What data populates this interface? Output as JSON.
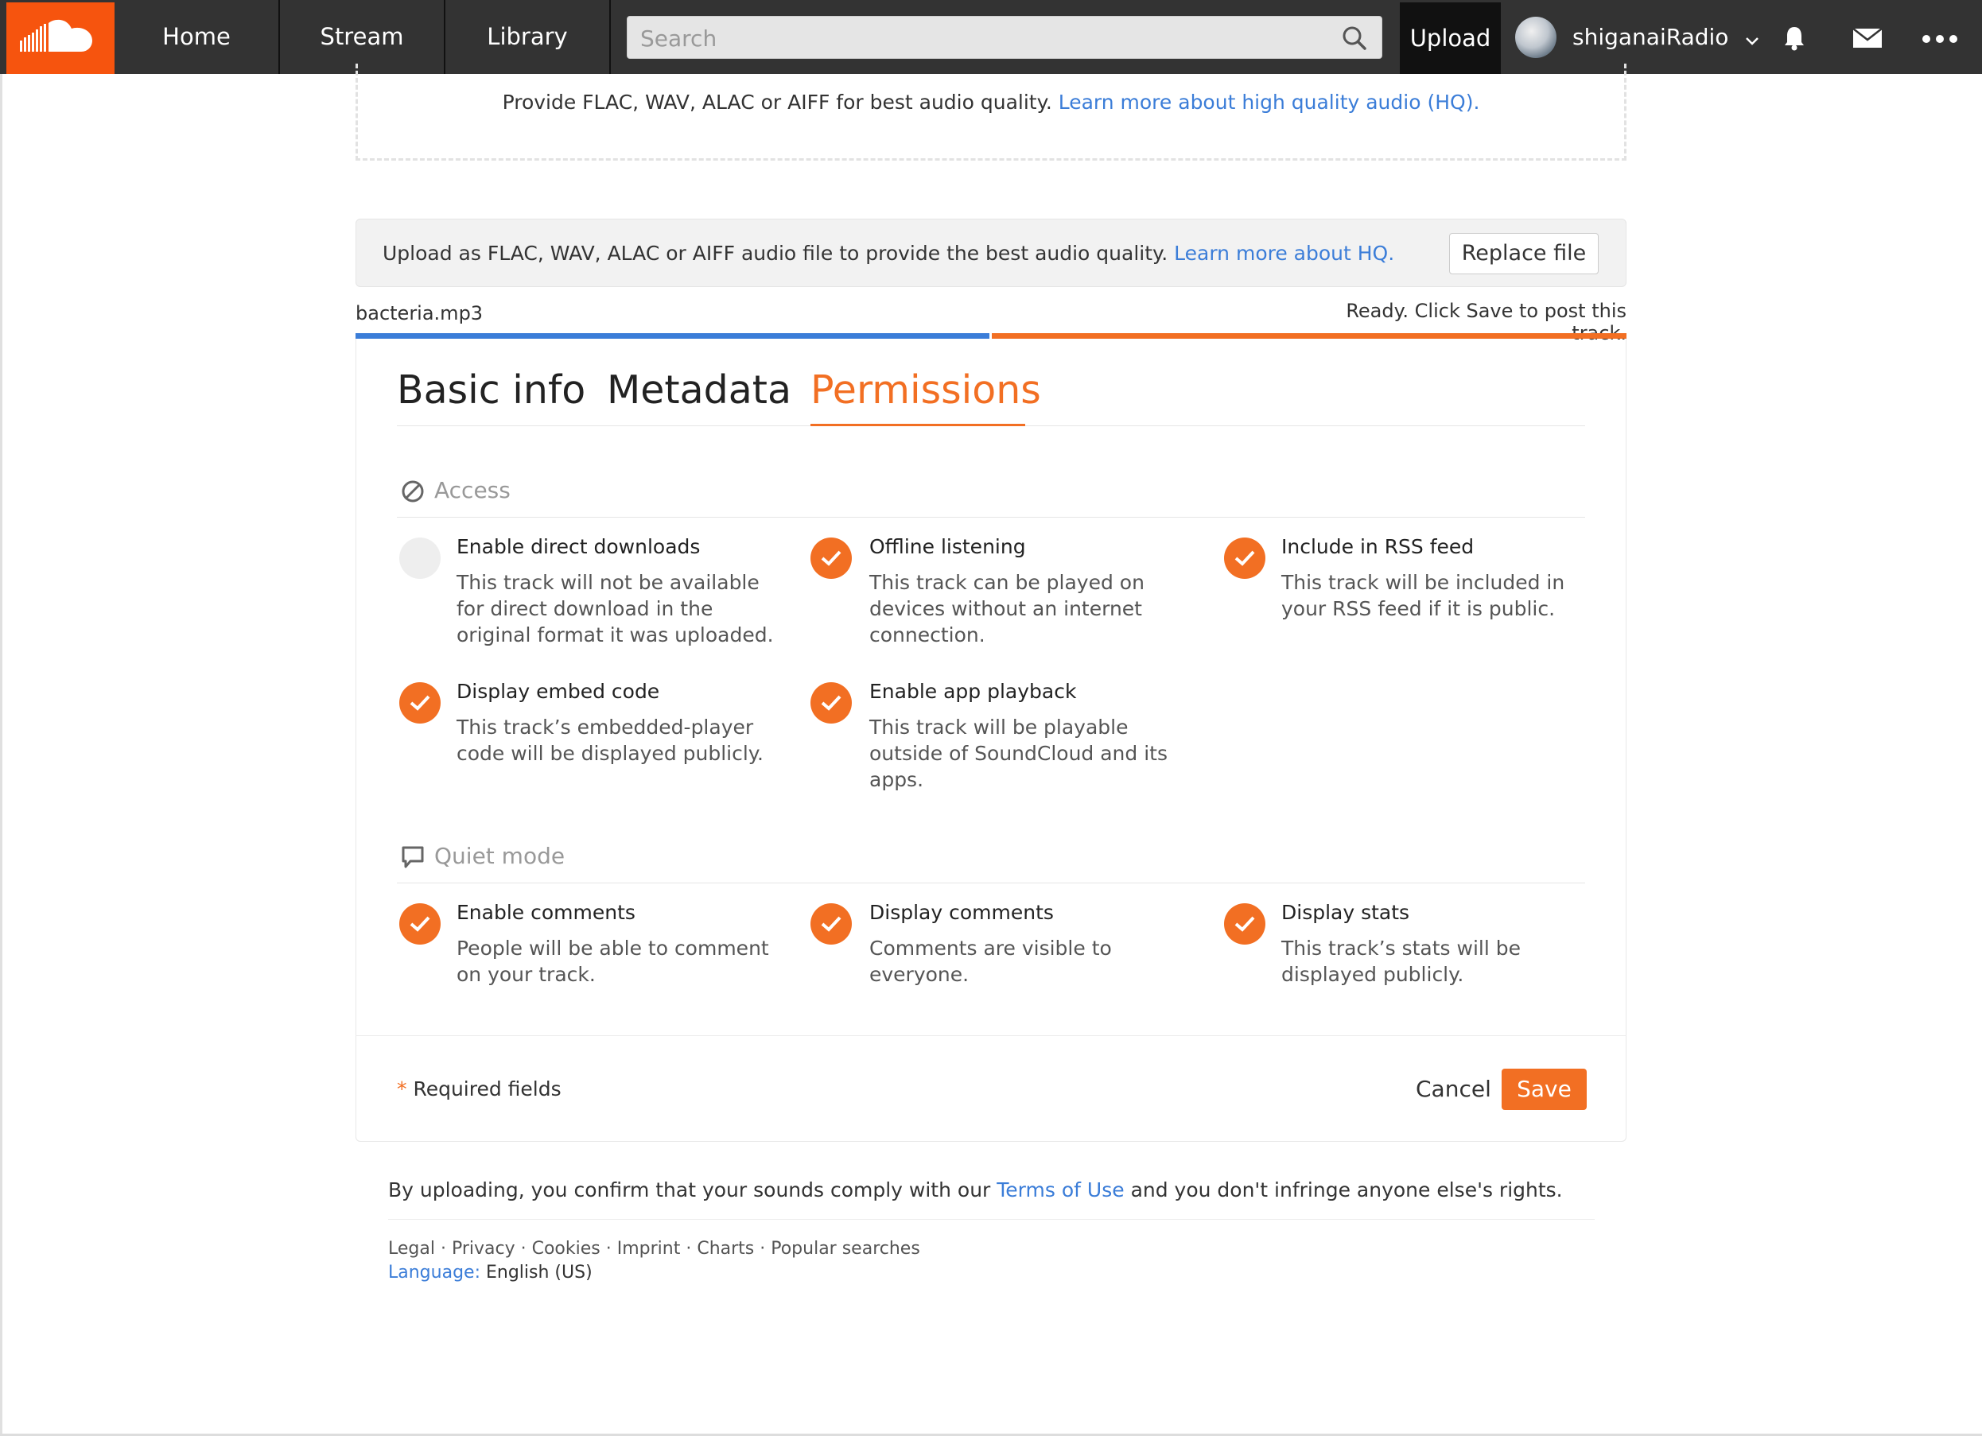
{
  "nav": {
    "home": "Home",
    "stream": "Stream",
    "library": "Library",
    "search_placeholder": "Search",
    "upload": "Upload",
    "username": "shiganaiRadio"
  },
  "top_note": {
    "text": "Provide FLAC, WAV, ALAC or AIFF for best audio quality.",
    "link": "Learn more about high quality audio (HQ)."
  },
  "notice": {
    "text": "Upload as FLAC, WAV, ALAC or AIFF audio file to provide the best audio quality.",
    "link": "Learn more about HQ.",
    "replace_button": "Replace file"
  },
  "file": {
    "name": "bacteria.mp3",
    "status": "Ready. Click Save to post this track."
  },
  "tabs": {
    "basic": "Basic info",
    "metadata": "Metadata",
    "permissions": "Permissions"
  },
  "access": {
    "heading": "Access",
    "options": [
      {
        "title": "Enable direct downloads",
        "desc": "This track will not be available for direct download in the original format it was uploaded.",
        "checked": false
      },
      {
        "title": "Offline listening",
        "desc": "This track can be played on devices without an internet connection.",
        "checked": true
      },
      {
        "title": "Include in RSS feed",
        "desc": "This track will be included in your RSS feed if it is public.",
        "checked": true
      },
      {
        "title": "Display embed code",
        "desc": "This track’s embedded-player code will be displayed publicly.",
        "checked": true
      },
      {
        "title": "Enable app playback",
        "desc": "This track will be playable outside of SoundCloud and its apps.",
        "checked": true
      }
    ]
  },
  "quiet": {
    "heading": "Quiet mode",
    "options": [
      {
        "title": "Enable comments",
        "desc": "People will be able to comment on your track.",
        "checked": true
      },
      {
        "title": "Display comments",
        "desc": "Comments are visible to everyone.",
        "checked": true
      },
      {
        "title": "Display stats",
        "desc": "This track’s stats will be displayed publicly.",
        "checked": true
      }
    ]
  },
  "footer": {
    "required_star": "*",
    "required": "Required fields",
    "cancel": "Cancel",
    "save": "Save"
  },
  "legal": {
    "prefix": "By uploading, you confirm that your sounds comply with our",
    "terms": "Terms of Use",
    "suffix": "and you don't infringe anyone else's rights.",
    "links": [
      "Legal",
      "Privacy",
      "Cookies",
      "Imprint",
      "Charts",
      "Popular searches"
    ],
    "language_label": "Language:",
    "language_value": "English (US)"
  },
  "colors": {
    "accent": "#f26f23",
    "brand": "#f6540e",
    "link": "#3b7dd8",
    "topbar": "#333333"
  }
}
